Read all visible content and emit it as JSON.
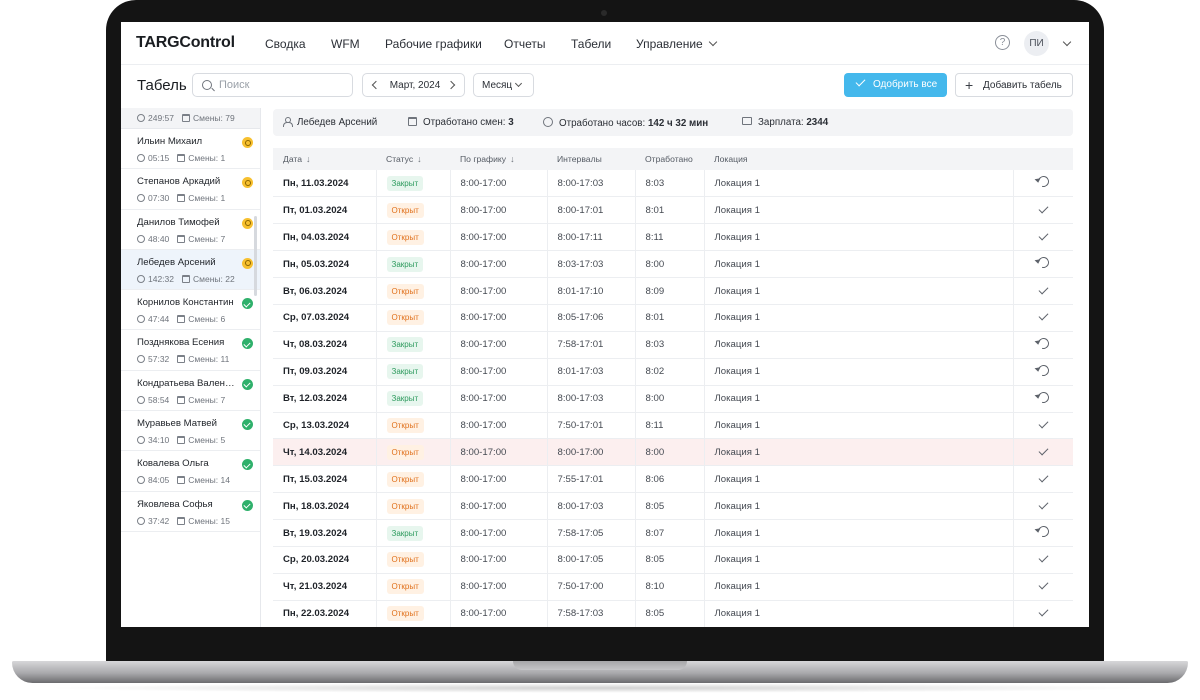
{
  "header": {
    "logo": "TARGControl",
    "nav": [
      "Сводка",
      "WFM",
      "Рабочие графики",
      "Отчеты",
      "Табели",
      "Управление"
    ],
    "help_icon": "?",
    "user_initials": "ПИ"
  },
  "toolbar": {
    "title": "Табель",
    "search_placeholder": "Поиск",
    "month": "Март, 2024",
    "period": "Месяц",
    "approve_all": "Одобрить все",
    "add_timesheet": "Добавить табель"
  },
  "employees_summary": {
    "hours": "249:57",
    "shifts": "Смены: 79"
  },
  "employees": [
    {
      "name": "Ильин Михаил",
      "hours": "05:15",
      "shifts": "Смены: 1",
      "status": "warning"
    },
    {
      "name": "Степанов Аркадий",
      "hours": "07:30",
      "shifts": "Смены: 1",
      "status": "warning"
    },
    {
      "name": "Данилов Тимофей",
      "hours": "48:40",
      "shifts": "Смены: 7",
      "status": "warning"
    },
    {
      "name": "Лебедев Арсений",
      "hours": "142:32",
      "shifts": "Смены: 22",
      "status": "warning",
      "selected": true
    },
    {
      "name": "Корнилов Константин",
      "hours": "47:44",
      "shifts": "Смены: 6",
      "status": "approved"
    },
    {
      "name": "Позднякова Есения",
      "hours": "57:32",
      "shifts": "Смены: 11",
      "status": "approved"
    },
    {
      "name": "Кондратьева Вален…",
      "hours": "58:54",
      "shifts": "Смены: 7",
      "status": "approved"
    },
    {
      "name": "Муравьев Матвей",
      "hours": "34:10",
      "shifts": "Смены: 5",
      "status": "approved"
    },
    {
      "name": "Ковалева Ольга",
      "hours": "84:05",
      "shifts": "Смены: 14",
      "status": "approved"
    },
    {
      "name": "Яковлева Софья",
      "hours": "37:42",
      "shifts": "Смены: 15",
      "status": "approved"
    }
  ],
  "summary": {
    "employee": "Лебедев Арсений",
    "shifts_label": "Отработано смен:",
    "shifts_value": "3",
    "hours_label": "Отработано часов:",
    "hours_value": "142 ч 32 мин",
    "salary_label": "Зарплата:",
    "salary_value": "2344"
  },
  "table": {
    "columns": [
      "Дата",
      "Статус",
      "По графику",
      "Интервалы",
      "Отработано",
      "Локация"
    ],
    "rows": [
      {
        "date": "Пн, 11.03.2024",
        "status": "Закрыт",
        "schedule": "8:00-17:00",
        "interval": "8:00-17:03",
        "worked": "8:03",
        "location": "Локация 1",
        "action": "undo"
      },
      {
        "date": "Пт, 01.03.2024",
        "status": "Открыт",
        "schedule": "8:00-17:00",
        "interval": "8:00-17:01",
        "worked": "8:01",
        "location": "Локация 1",
        "action": "approve"
      },
      {
        "date": "Пн, 04.03.2024",
        "status": "Открыт",
        "schedule": "8:00-17:00",
        "interval": "8:00-17:11",
        "worked": "8:11",
        "location": "Локация 1",
        "action": "approve"
      },
      {
        "date": "Пн, 05.03.2024",
        "status": "Закрыт",
        "schedule": "8:00-17:00",
        "interval": "8:03-17:03",
        "worked": "8:00",
        "location": "Локация 1",
        "action": "undo"
      },
      {
        "date": "Вт, 06.03.2024",
        "status": "Открыт",
        "schedule": "8:00-17:00",
        "interval": "8:01-17:10",
        "worked": "8:09",
        "location": "Локация 1",
        "action": "approve"
      },
      {
        "date": "Ср, 07.03.2024",
        "status": "Открыт",
        "schedule": "8:00-17:00",
        "interval": "8:05-17:06",
        "worked": "8:01",
        "location": "Локация 1",
        "action": "approve"
      },
      {
        "date": "Чт, 08.03.2024",
        "status": "Закрыт",
        "schedule": "8:00-17:00",
        "interval": "7:58-17:01",
        "worked": "8:03",
        "location": "Локация 1",
        "action": "undo"
      },
      {
        "date": "Пт, 09.03.2024",
        "status": "Закрыт",
        "schedule": "8:00-17:00",
        "interval": "8:01-17:03",
        "worked": "8:02",
        "location": "Локация 1",
        "action": "undo"
      },
      {
        "date": "Вт, 12.03.2024",
        "status": "Закрыт",
        "schedule": "8:00-17:00",
        "interval": "8:00-17:03",
        "worked": "8:00",
        "location": "Локация 1",
        "action": "undo"
      },
      {
        "date": "Ср, 13.03.2024",
        "status": "Открыт",
        "schedule": "8:00-17:00",
        "interval": "7:50-17:01",
        "worked": "8:11",
        "location": "Локация 1",
        "action": "approve"
      },
      {
        "date": "Чт, 14.03.2024",
        "status": "Открыт",
        "schedule": "8:00-17:00",
        "interval": "8:00-17:00",
        "worked": "8:00",
        "location": "Локация 1",
        "action": "approve",
        "highlight": true
      },
      {
        "date": "Пт, 15.03.2024",
        "status": "Открыт",
        "schedule": "8:00-17:00",
        "interval": "7:55-17:01",
        "worked": "8:06",
        "location": "Локация 1",
        "action": "approve"
      },
      {
        "date": "Пн, 18.03.2024",
        "status": "Открыт",
        "schedule": "8:00-17:00",
        "interval": "8:00-17:03",
        "worked": "8:05",
        "location": "Локация 1",
        "action": "approve"
      },
      {
        "date": "Вт, 19.03.2024",
        "status": "Закрыт",
        "schedule": "8:00-17:00",
        "interval": "7:58-17:05",
        "worked": "8:07",
        "location": "Локация 1",
        "action": "undo"
      },
      {
        "date": "Ср, 20.03.2024",
        "status": "Открыт",
        "schedule": "8:00-17:00",
        "interval": "8:00-17:05",
        "worked": "8:05",
        "location": "Локация 1",
        "action": "approve"
      },
      {
        "date": "Чт, 21.03.2024",
        "status": "Открыт",
        "schedule": "8:00-17:00",
        "interval": "7:50-17:00",
        "worked": "8:10",
        "location": "Локация 1",
        "action": "approve"
      },
      {
        "date": "Пн, 22.03.2024",
        "status": "Открыт",
        "schedule": "8:00-17:00",
        "interval": "7:58-17:03",
        "worked": "8:05",
        "location": "Локация 1",
        "action": "approve"
      }
    ]
  },
  "colors": {
    "accent": "#44b8ec",
    "closed_badge": "#2d9a5d",
    "open_badge": "#e0711c",
    "approved_status": "#2fb06b",
    "warning_status": "#f7c02f",
    "highlight_row": "#fcefef"
  }
}
